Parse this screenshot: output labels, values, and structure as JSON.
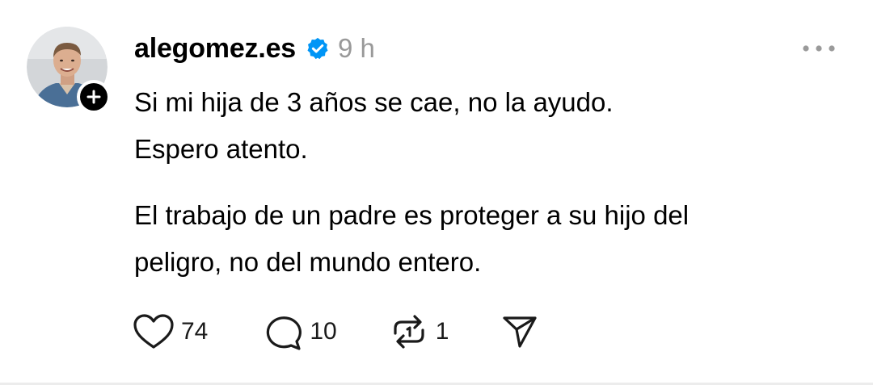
{
  "post": {
    "author": {
      "username": "alegomez.es",
      "verified": true,
      "avatar_icon": "profile-photo"
    },
    "time": "9 h",
    "paragraphs": [
      {
        "lines": [
          "Si mi hija de 3 años se cae, no la ayudo.",
          "Espero atento."
        ]
      },
      {
        "lines": [
          "El trabajo de un padre es proteger a su hijo del",
          "peligro, no del mundo entero."
        ]
      }
    ],
    "actions": {
      "likes": "74",
      "replies": "10",
      "reposts": "1"
    }
  },
  "colors": {
    "verified_blue": "#0095f6",
    "muted_text": "#999999",
    "text": "#000000",
    "divider": "#ececec"
  },
  "icons": {
    "more": "more-horizontal-icon",
    "like": "heart-icon",
    "reply": "comment-icon",
    "repost": "repost-icon",
    "share": "send-icon",
    "follow": "plus-icon",
    "verified": "verified-badge-icon"
  }
}
